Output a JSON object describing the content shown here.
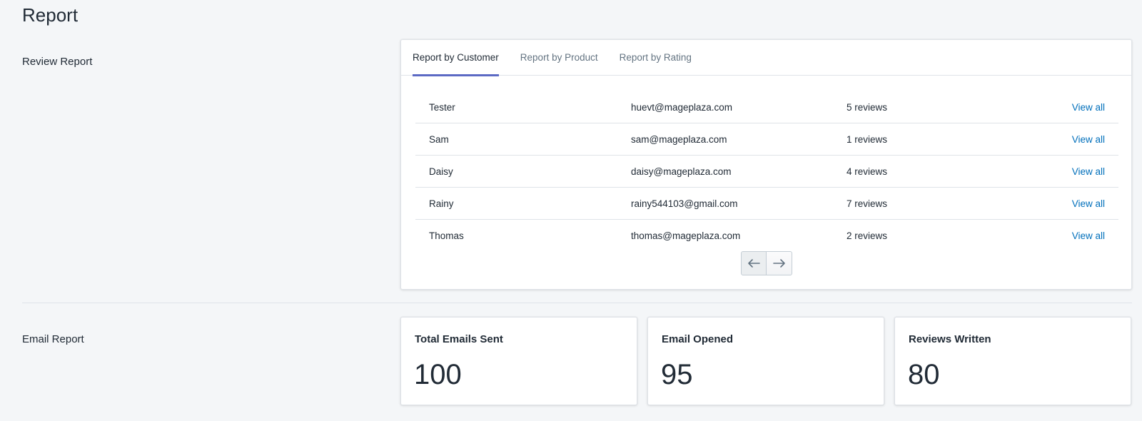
{
  "page": {
    "title": "Report"
  },
  "review_report": {
    "label": "Review Report",
    "tabs": [
      {
        "label": "Report by Customer",
        "active": true
      },
      {
        "label": "Report by Product",
        "active": false
      },
      {
        "label": "Report by Rating",
        "active": false
      }
    ],
    "rows": [
      {
        "name": "Tester",
        "email": "huevt@mageplaza.com",
        "count": "5 reviews",
        "link": "View all"
      },
      {
        "name": "Sam",
        "email": "sam@mageplaza.com",
        "count": "1 reviews",
        "link": "View all"
      },
      {
        "name": "Daisy",
        "email": "daisy@mageplaza.com",
        "count": "4 reviews",
        "link": "View all"
      },
      {
        "name": "Rainy",
        "email": "rainy544103@gmail.com",
        "count": "7 reviews",
        "link": "View all"
      },
      {
        "name": "Thomas",
        "email": "thomas@mageplaza.com",
        "count": "2 reviews",
        "link": "View all"
      }
    ],
    "pagination": {
      "prev_icon": "arrow-left-icon",
      "next_icon": "arrow-right-icon"
    }
  },
  "email_report": {
    "label": "Email Report",
    "stats": [
      {
        "title": "Total Emails Sent",
        "value": "100"
      },
      {
        "title": "Email Opened",
        "value": "95"
      },
      {
        "title": "Reviews Written",
        "value": "80"
      }
    ]
  },
  "colors": {
    "background": "#f4f6f8",
    "accent": "#5c6ac4",
    "link": "#006fbb",
    "text": "#212b36",
    "muted": "#637381"
  }
}
